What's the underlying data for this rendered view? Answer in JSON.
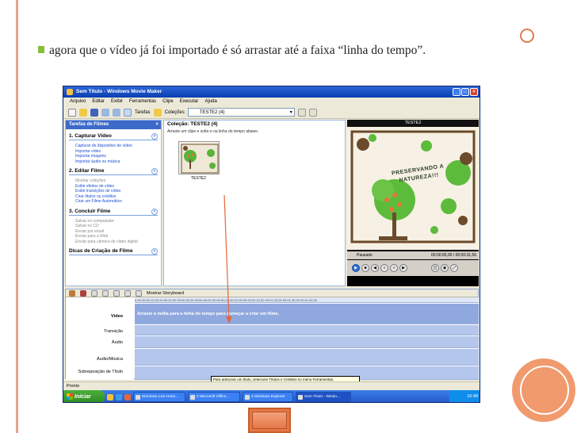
{
  "slide": {
    "bullet_text": "agora que o vídeo já foi importado é só arrastar até a faixa “linha do tempo”."
  },
  "window": {
    "title": "Sem Título - Windows Movie Maker",
    "menu": [
      "Arquivo",
      "Editar",
      "Exibir",
      "Ferramentas",
      "Clipe",
      "Executar",
      "Ajuda"
    ],
    "toolbar": {
      "tasks_label": "Tarefas",
      "collections_label": "Coleções",
      "collection_select": "TESTE2 (4)"
    }
  },
  "tasks_pane": {
    "header": "Tarefas de Filmes",
    "sections": [
      {
        "title": "1. Capturar Vídeo",
        "items": [
          {
            "text": "Capturar do dispositivo de vídeo",
            "enabled": true
          },
          {
            "text": "Importar vídeo",
            "enabled": true
          },
          {
            "text": "Importar imagens",
            "enabled": true
          },
          {
            "text": "Importar áudio ou música",
            "enabled": true
          }
        ]
      },
      {
        "title": "2. Editar Filme",
        "items": [
          {
            "text": "Mostrar coleções",
            "enabled": false
          },
          {
            "text": "Exibir efeitos de vídeo",
            "enabled": true
          },
          {
            "text": "Exibir transições de vídeo",
            "enabled": true
          },
          {
            "text": "Criar títulos ou créditos",
            "enabled": true
          },
          {
            "text": "Criar um Filme Automático",
            "enabled": true
          }
        ]
      },
      {
        "title": "3. Concluir Filme",
        "items": [
          {
            "text": "Salvar no computador",
            "enabled": false
          },
          {
            "text": "Salvar no CD",
            "enabled": false
          },
          {
            "text": "Enviar por email",
            "enabled": false
          },
          {
            "text": "Enviar para a Web",
            "enabled": false
          },
          {
            "text": "Enviar para câmera de vídeo digital",
            "enabled": false
          }
        ]
      }
    ],
    "footer_section": "Dicas de Criação de Filme"
  },
  "collection": {
    "title": "Coleção: TESTE2 (4)",
    "hint": "Arraste um clipe e solte-o na linha do tempo abaixo.",
    "clip_label": "TESTE2"
  },
  "player": {
    "title": "TESTE2",
    "screen_text": "PRESERVANDO A NATUREZA!!!",
    "status": "Pausado",
    "time": "00:00:00,00 / 00:00:31,56"
  },
  "timeline": {
    "toolbar_label": "Mostrar Storyboard",
    "ruler": "0,00  00:00:10,00  00:00:20,00  00:00:30,00  00:00:40,00  00:00:50,00  00:01:00,00  00:01:10,00  00:01:20,00  00:01:30,00  00:01:40,00",
    "track_labels": [
      "Vídeo",
      "Transição",
      "Áudio",
      "Áudio/Música",
      "Sobreposição de Título"
    ],
    "drop_hint": "Arraste a mídia para a linha do tempo para começar a criar um filme.",
    "tooltip": "Para adicionar um título, selecione Títulos e Créditos no menu Ferramentas."
  },
  "status_bar": {
    "text": "Pronto"
  },
  "taskbar": {
    "start_label": "Iniciar",
    "buttons": [
      {
        "label": "Windows Live Hotm...",
        "active": false
      },
      {
        "label": "2 Microsoft Office...",
        "active": false
      },
      {
        "label": "2 Windows Explorer",
        "active": false
      },
      {
        "label": "Sem Título - Windo...",
        "active": true
      }
    ],
    "clock": "16:48"
  },
  "colors": {
    "accent": "#f09a6d",
    "bullet": "#86bf3a",
    "arrow": "#e8643a",
    "xp_blue": "#2559c8"
  }
}
